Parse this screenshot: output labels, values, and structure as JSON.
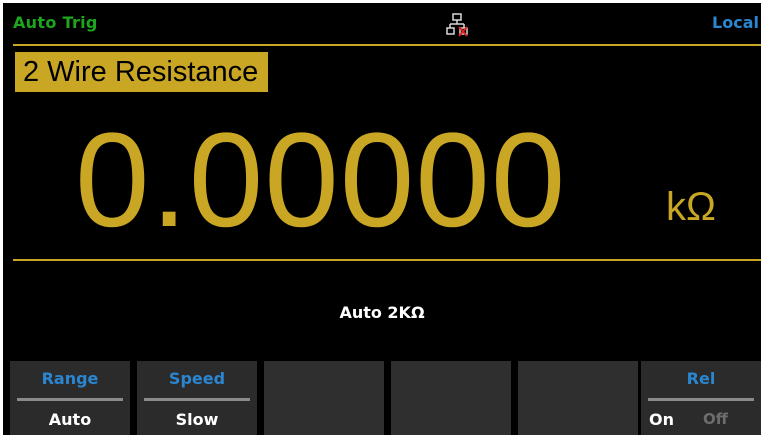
{
  "status": {
    "trigger_mode": "Auto Trig",
    "control_mode": "Local",
    "network_icon": "network-disconnected-icon"
  },
  "display": {
    "function_label": "2 Wire Resistance",
    "reading": "0.00000",
    "unit": "kΩ",
    "range_info": "Auto  2KΩ"
  },
  "softkeys": [
    {
      "title": "Range",
      "value": "Auto"
    },
    {
      "title": "Speed",
      "value": "Slow"
    },
    {
      "title": "",
      "value": ""
    },
    {
      "title": "",
      "value": ""
    },
    {
      "title": "",
      "value": ""
    },
    {
      "title": "Rel",
      "on_label": "On",
      "off_label": "Off",
      "selected": "On"
    }
  ],
  "colors": {
    "accent_yellow": "#c9a623",
    "status_green": "#1ea51e",
    "softkey_blue": "#2a86d0",
    "background": "#000000"
  }
}
